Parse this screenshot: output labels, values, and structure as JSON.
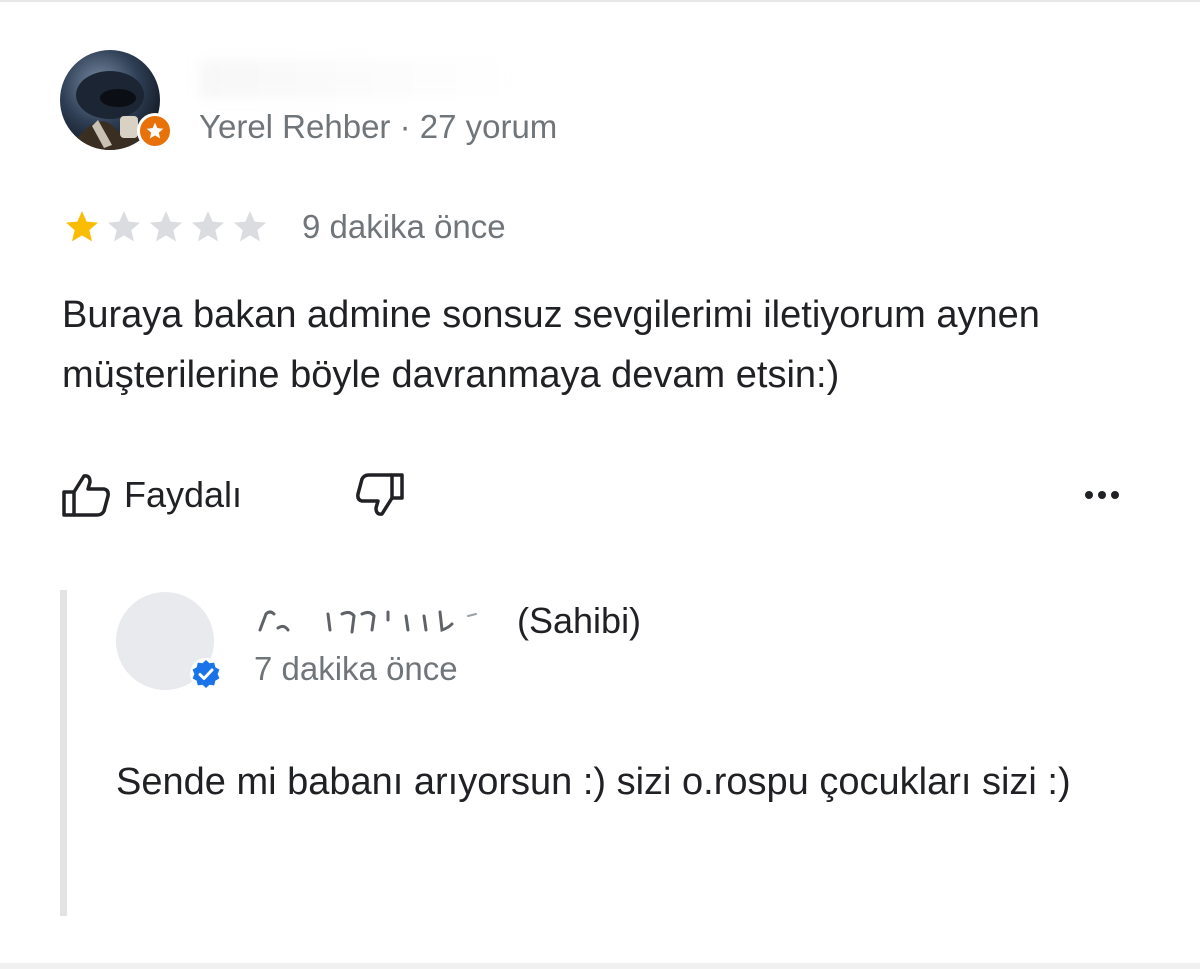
{
  "review": {
    "reviewer_meta": "Yerel Rehber · 27 yorum",
    "rating": 1,
    "rating_max": 5,
    "time": "9 dakika önce",
    "text": "Buraya bakan admine sonsuz sevgilerimi iletiyorum aynen müşterilerine böyle davranmaya devam etsin:)",
    "actions": {
      "helpful_label": "Faydalı",
      "helpful_icon": "thumbs-up-icon",
      "unhelpful_icon": "thumbs-down-icon",
      "more_icon": "more-horizontal-icon"
    }
  },
  "owner_reply": {
    "role": "(Sahibi)",
    "time": "7 dakika önce",
    "text": "Sende mi babanı arıyorsun :) sizi o.rospu çocukları sizi :)",
    "badge_icon": "verified-check-icon"
  },
  "colors": {
    "star_filled": "#fbbc04",
    "star_empty": "#dadce0",
    "secondary_text": "#70757a",
    "local_guide_badge": "#e8710a",
    "verified_badge": "#1a73e8"
  }
}
